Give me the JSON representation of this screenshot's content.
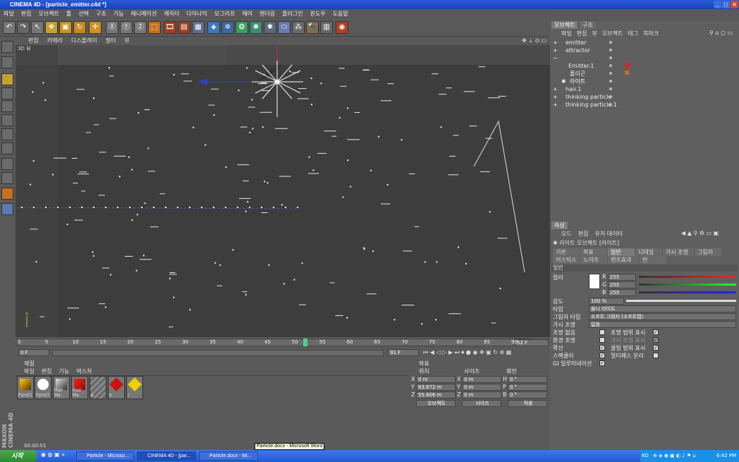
{
  "window": {
    "title": "CINEMA 4D - [particle_emitter.c4d *]"
  },
  "menu": [
    "파일",
    "편집",
    "오브젝트",
    "툴",
    "선택",
    "구조",
    "기능",
    "애니메이션",
    "캐릭터",
    "다이나믹",
    "모그라프",
    "헤어",
    "렌더링",
    "플러그인",
    "윈도우",
    "도움말"
  ],
  "viewport": {
    "menu": [
      "편집",
      "카메라",
      "디스플레이",
      "필터",
      "뷰"
    ],
    "label": "3D 뷰"
  },
  "timeline": {
    "ticks": [
      "0",
      "5",
      "10",
      "15",
      "20",
      "25",
      "30",
      "35",
      "40",
      "45",
      "50",
      "55",
      "60",
      "65",
      "70",
      "75",
      "80",
      "85",
      "90"
    ],
    "current_frame": "52",
    "end_frame_field": "52 F",
    "start_field": "0 F",
    "end_field": "91 F"
  },
  "materials": {
    "title": "재질",
    "menu": [
      "파일",
      "편집",
      "기능",
      "텍스쳐"
    ],
    "items": [
      "PyroCl",
      "PyroCl",
      "Hair Ma",
      "Hair Ma",
      "a",
      "b",
      "c"
    ],
    "time": "00:00:01"
  },
  "coords": {
    "title": "좌표",
    "headers": [
      "위치",
      "사이즈",
      "회전"
    ],
    "rows": [
      {
        "axis": "X",
        "pos": "0 m",
        "size_axis": "X",
        "size": "0 m",
        "rot_axis": "H",
        "rot": "0 °"
      },
      {
        "axis": "Y",
        "pos": "83.672 m",
        "size_axis": "Y",
        "size": "0 m",
        "rot_axis": "P",
        "rot": "0 °"
      },
      {
        "axis": "Z",
        "pos": "55.806 m",
        "size_axis": "Z",
        "size": "0 m",
        "rot_axis": "B",
        "rot": "0 °"
      }
    ],
    "mode1": "오브젝트",
    "mode2": "사이즈",
    "apply": "적용"
  },
  "objects": {
    "tabs": [
      "오브젝트",
      "구조"
    ],
    "menu": [
      "파일",
      "편집",
      "뷰",
      "오브젝트",
      "태그",
      "북마크"
    ],
    "rows": [
      "emitter",
      "attractor",
      "",
      "Emitter.1",
      "폴리곤",
      "라이트",
      "hair.1",
      "thinking particle",
      "thinking particle.1"
    ]
  },
  "attributes": {
    "title": "속성",
    "menu": [
      "모드",
      "편집",
      "유저 데이터"
    ],
    "object_label": "라이트 오브젝트 [라이트]",
    "tabs_row1": [
      "기본",
      "좌표",
      "일반",
      "디테일",
      "가시 조명",
      "그림자"
    ],
    "tabs_row2": [
      "커스틱스",
      "노이즈",
      "렌즈효과",
      "씬"
    ],
    "section": "일반",
    "color_label": "컬러",
    "r": "255",
    "g": "255",
    "b": "255",
    "intensity_label": "강도",
    "intensity": "100 %",
    "type_label": "타입",
    "type_value": "옴니 라이트",
    "shadow_label": "그림자 타입",
    "shadow_value": "소프트 그림자 (소프트맵)",
    "visible_label": "가시 조명",
    "visible_value": "없음",
    "checks_left": [
      "조명 없음",
      "환경 조명",
      "확산",
      "스펙큘러",
      "GI 일루미네이션"
    ],
    "checks_right": [
      "조명 범위 표시",
      "가시 조명 표시",
      "클립 범위 표시",
      "멀티패스 분리"
    ]
  },
  "taskbar": {
    "start": "시작",
    "tasks": [
      "Particle - Microso...",
      "CINEMA 4D - [par...",
      "Particle.docx - Mi..."
    ],
    "tooltip": "Particle.docx - Microsoft Word",
    "lang": "KO",
    "clock": "6:42 PM"
  },
  "colors": {
    "accent_blue": "#2a5bd7",
    "viewport": "#4a4a4a",
    "panel": "#5f5f5f"
  }
}
